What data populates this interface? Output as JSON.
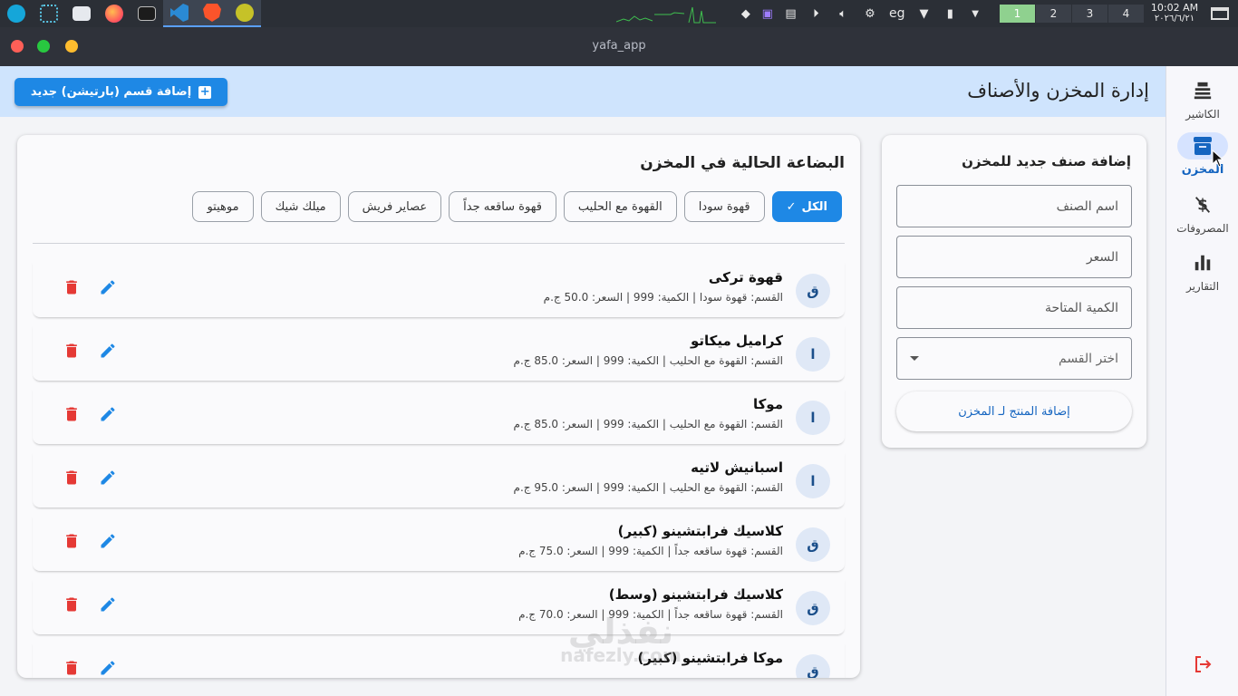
{
  "taskbar": {
    "tray_lang": "eg",
    "workspaces": [
      "1",
      "2",
      "3",
      "4"
    ],
    "clock_time": "10:02 AM",
    "clock_date": "٢٠٢٦/٦/٢١",
    "apps": [
      "zorin-menu-icon",
      "network-app-icon",
      "files-icon",
      "firefox-icon",
      "terminal-icon",
      "vscode-icon",
      "brave-icon",
      "wps-icon"
    ]
  },
  "window": {
    "title": "yafa_app"
  },
  "nav": {
    "items": [
      {
        "label": "الكاشير",
        "icon": "cash-register-icon"
      },
      {
        "label": "المخزن",
        "icon": "archive-box-icon"
      },
      {
        "label": "المصروفات",
        "icon": "money-off-icon"
      },
      {
        "label": "التقارير",
        "icon": "bar-chart-icon"
      }
    ],
    "active": "المخزن",
    "logout_icon": "logout-icon"
  },
  "header": {
    "title": "إدارة المخزن والأصناف",
    "add_section_label": "إضافة قسم (بارتيشن) جديد"
  },
  "add_form": {
    "title": "إضافة صنف جديد للمخزن",
    "name_placeholder": "اسم الصنف",
    "price_placeholder": "السعر",
    "qty_placeholder": "الكمية المتاحة",
    "category_placeholder": "اختر القسم",
    "submit_label": "إضافة المنتج لـ المخزن"
  },
  "inventory": {
    "title": "البضاعة الحالية في المخزن",
    "filters": [
      "الكل",
      "قهوة سودا",
      "القهوة مع الحليب",
      "قهوة ساقعه جداً",
      "عصاير فريش",
      "ميلك شيك",
      "موهيتو"
    ],
    "selected_filter": "الكل",
    "items": [
      {
        "avatar": "ق",
        "name": "قهوة تركى",
        "details": "القسم: قهوة سودا | الكمية: 999 | السعر: 50.0 ج.م"
      },
      {
        "avatar": "ا",
        "name": "كراميل ميكاتو",
        "details": "القسم: القهوة مع الحليب | الكمية: 999 | السعر: 85.0 ج.م"
      },
      {
        "avatar": "ا",
        "name": "موكا",
        "details": "القسم: القهوة مع الحليب | الكمية: 999 | السعر: 85.0 ج.م"
      },
      {
        "avatar": "ا",
        "name": "اسبانيش لاتيه",
        "details": "القسم: القهوة مع الحليب | الكمية: 999 | السعر: 95.0 ج.م"
      },
      {
        "avatar": "ق",
        "name": "كلاسيك فرابتشينو (كبير)",
        "details": "القسم: قهوة ساقعه جداً | الكمية: 999 | السعر: 75.0 ج.م"
      },
      {
        "avatar": "ق",
        "name": "كلاسيك فرابتشينو (وسط)",
        "details": "القسم: قهوة ساقعه جداً | الكمية: 999 | السعر: 70.0 ج.م"
      },
      {
        "avatar": "ق",
        "name": "موكا فرابتشينو (كبير)",
        "details": ""
      }
    ]
  },
  "watermark": {
    "arabic": "نفذلي",
    "latin": "nafezly.com"
  },
  "colors": {
    "accent": "#1e88e5",
    "header_bg": "#cfe4fd",
    "delete": "#e53935",
    "edit": "#1e88e5"
  }
}
